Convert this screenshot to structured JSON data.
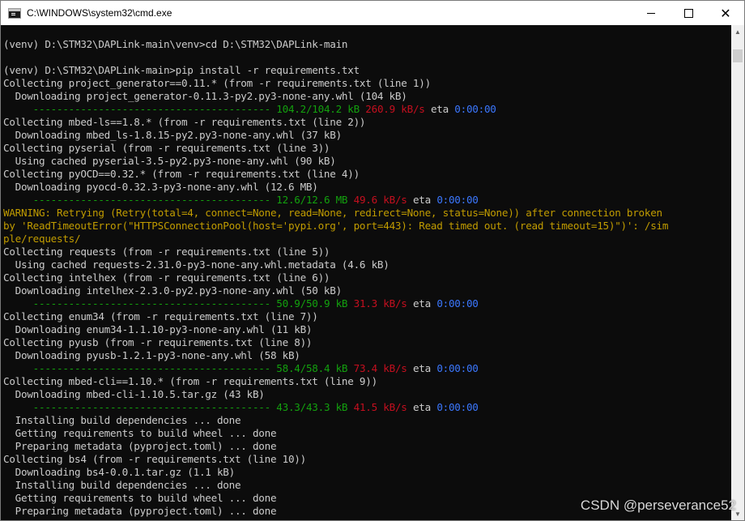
{
  "window": {
    "title": "C:\\WINDOWS\\system32\\cmd.exe",
    "controls": {
      "minimize": "",
      "maximize": "",
      "close": "✕"
    }
  },
  "console": {
    "lines": [
      {
        "type": "text",
        "text": "(venv) D:\\STM32\\DAPLink-main\\venv>cd D:\\STM32\\DAPLink-main"
      },
      {
        "type": "text",
        "text": ""
      },
      {
        "type": "text",
        "text": "(venv) D:\\STM32\\DAPLink-main>pip install -r requirements.txt"
      },
      {
        "type": "text",
        "text": "Collecting project_generator==0.11.* (from -r requirements.txt (line 1))"
      },
      {
        "type": "text",
        "text": "  Downloading project_generator-0.11.3-py2.py3-none-any.whl (104 kB)"
      },
      {
        "type": "progress",
        "dashes": "     ---------------------------------------- ",
        "size": "104.2/104.2 kB",
        "rate": "260.9 kB/s",
        "eta_label": "eta",
        "eta": "0:00:00"
      },
      {
        "type": "text",
        "text": "Collecting mbed-ls==1.8.* (from -r requirements.txt (line 2))"
      },
      {
        "type": "text",
        "text": "  Downloading mbed_ls-1.8.15-py2.py3-none-any.whl (37 kB)"
      },
      {
        "type": "text",
        "text": "Collecting pyserial (from -r requirements.txt (line 3))"
      },
      {
        "type": "text",
        "text": "  Using cached pyserial-3.5-py2.py3-none-any.whl (90 kB)"
      },
      {
        "type": "text",
        "text": "Collecting pyOCD==0.32.* (from -r requirements.txt (line 4))"
      },
      {
        "type": "text",
        "text": "  Downloading pyocd-0.32.3-py3-none-any.whl (12.6 MB)"
      },
      {
        "type": "progress",
        "dashes": "     ---------------------------------------- ",
        "size": "12.6/12.6 MB",
        "rate": "49.6 kB/s",
        "eta_label": "eta",
        "eta": "0:00:00"
      },
      {
        "type": "warning",
        "text": "WARNING: Retrying (Retry(total=4, connect=None, read=None, redirect=None, status=None)) after connection broken"
      },
      {
        "type": "warning",
        "text": "by 'ReadTimeoutError(\"HTTPSConnectionPool(host='pypi.org', port=443): Read timed out. (read timeout=15)\")': /sim"
      },
      {
        "type": "warning",
        "text": "ple/requests/"
      },
      {
        "type": "text",
        "text": "Collecting requests (from -r requirements.txt (line 5))"
      },
      {
        "type": "text",
        "text": "  Using cached requests-2.31.0-py3-none-any.whl.metadata (4.6 kB)"
      },
      {
        "type": "text",
        "text": "Collecting intelhex (from -r requirements.txt (line 6))"
      },
      {
        "type": "text",
        "text": "  Downloading intelhex-2.3.0-py2.py3-none-any.whl (50 kB)"
      },
      {
        "type": "progress",
        "dashes": "     ---------------------------------------- ",
        "size": "50.9/50.9 kB",
        "rate": "31.3 kB/s",
        "eta_label": "eta",
        "eta": "0:00:00"
      },
      {
        "type": "text",
        "text": "Collecting enum34 (from -r requirements.txt (line 7))"
      },
      {
        "type": "text",
        "text": "  Downloading enum34-1.1.10-py3-none-any.whl (11 kB)"
      },
      {
        "type": "text",
        "text": "Collecting pyusb (from -r requirements.txt (line 8))"
      },
      {
        "type": "text",
        "text": "  Downloading pyusb-1.2.1-py3-none-any.whl (58 kB)"
      },
      {
        "type": "progress",
        "dashes": "     ---------------------------------------- ",
        "size": "58.4/58.4 kB",
        "rate": "73.4 kB/s",
        "eta_label": "eta",
        "eta": "0:00:00"
      },
      {
        "type": "text",
        "text": "Collecting mbed-cli==1.10.* (from -r requirements.txt (line 9))"
      },
      {
        "type": "text",
        "text": "  Downloading mbed-cli-1.10.5.tar.gz (43 kB)"
      },
      {
        "type": "progress",
        "dashes": "     ---------------------------------------- ",
        "size": "43.3/43.3 kB",
        "rate": "41.5 kB/s",
        "eta_label": "eta",
        "eta": "0:00:00"
      },
      {
        "type": "text",
        "text": "  Installing build dependencies ... done"
      },
      {
        "type": "text",
        "text": "  Getting requirements to build wheel ... done"
      },
      {
        "type": "text",
        "text": "  Preparing metadata (pyproject.toml) ... done"
      },
      {
        "type": "text",
        "text": "Collecting bs4 (from -r requirements.txt (line 10))"
      },
      {
        "type": "text",
        "text": "  Downloading bs4-0.0.1.tar.gz (1.1 kB)"
      },
      {
        "type": "text",
        "text": "  Installing build dependencies ... done"
      },
      {
        "type": "text",
        "text": "  Getting requirements to build wheel ... done"
      },
      {
        "type": "text",
        "text": "  Preparing metadata (pyproject.toml) ... done"
      }
    ]
  },
  "scrollbar": {
    "up_icon": "▲",
    "down_icon": "▼"
  },
  "watermark": "CSDN @perseverance52",
  "colors": {
    "background": "#0c0c0c",
    "text": "#cccccc",
    "progress": "#13a10e",
    "rate": "#c50f1f",
    "eta": "#3b78ff",
    "warning": "#c19c00"
  }
}
